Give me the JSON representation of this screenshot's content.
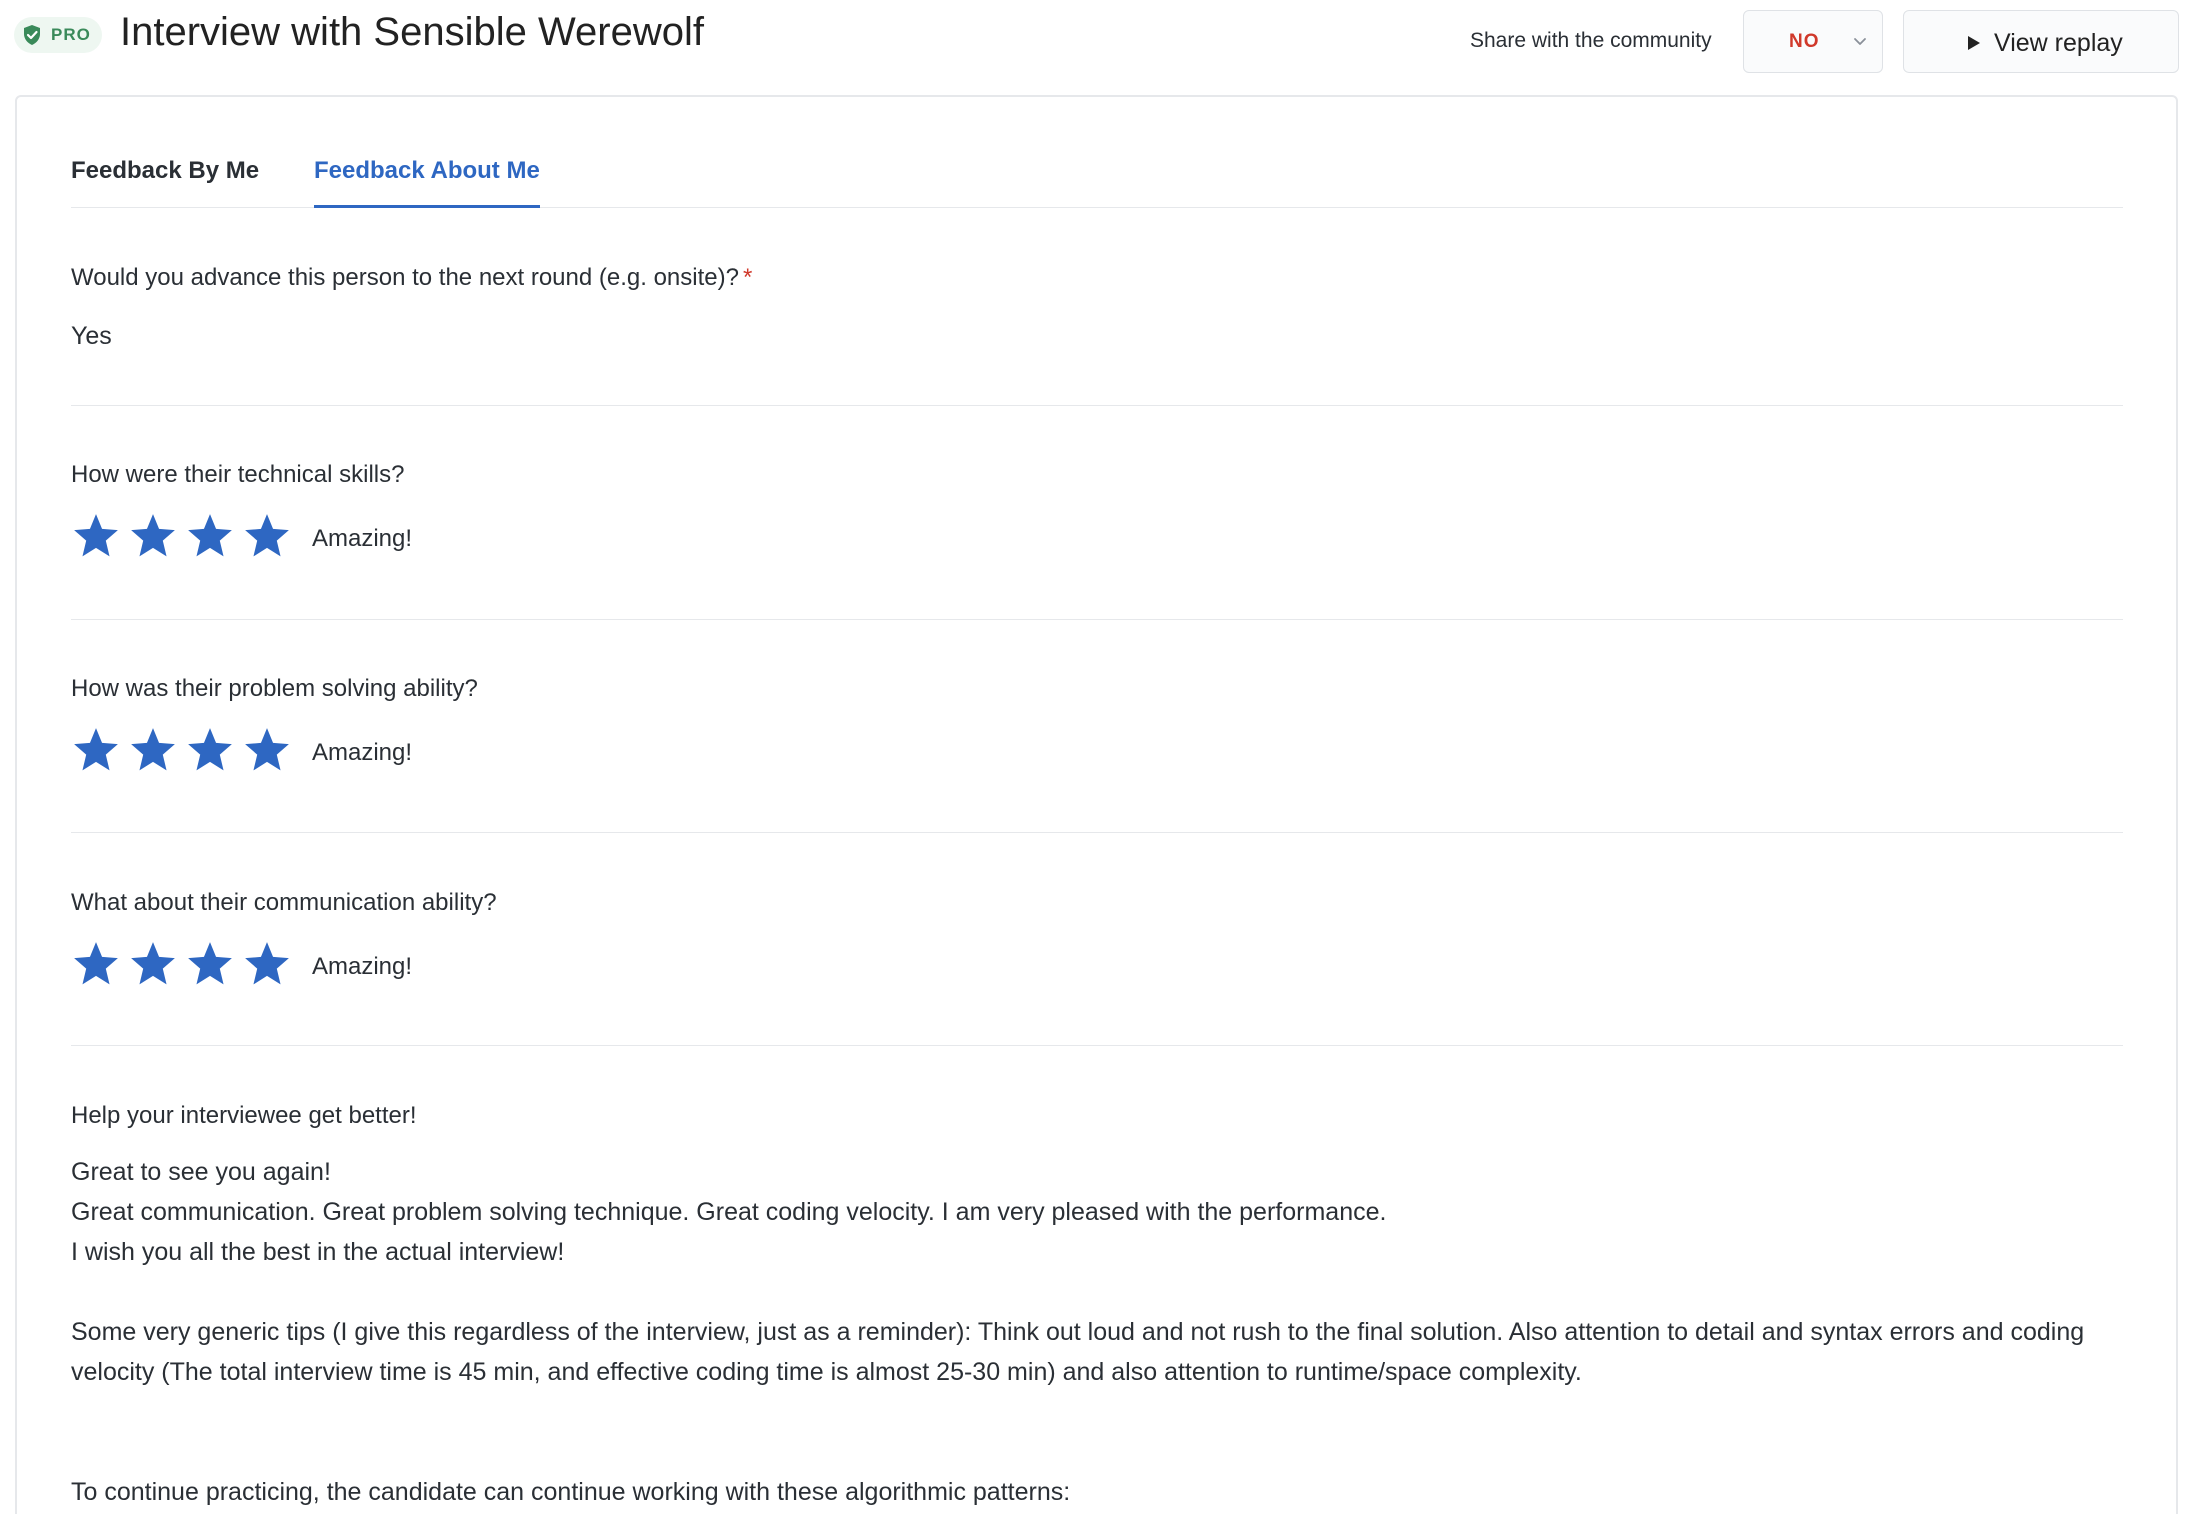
{
  "header": {
    "badge": "PRO",
    "title": "Interview with Sensible Werewolf",
    "share_label": "Share with the community",
    "share_value": "NO",
    "replay_label": "View replay"
  },
  "tabs": [
    {
      "label": "Feedback By Me",
      "active": false
    },
    {
      "label": "Feedback About Me",
      "active": true
    }
  ],
  "advance": {
    "question": "Would you advance this person to the next round (e.g. onsite)?",
    "required_mark": "*",
    "answer": "Yes"
  },
  "ratings": [
    {
      "question": "How were their technical skills?",
      "stars": 4,
      "label": "Amazing!"
    },
    {
      "question": "How was their problem solving ability?",
      "stars": 4,
      "label": "Amazing!"
    },
    {
      "question": "What about their communication ability?",
      "stars": 4,
      "label": "Amazing!"
    }
  ],
  "feedback": {
    "question": "Help your interviewee get better!",
    "lines": [
      "Great to see you again!",
      "Great communication. Great problem solving technique. Great coding velocity.  I am very pleased with the performance.",
      "I wish you all the best in the actual interview!",
      "",
      "Some very generic tips (I give this regardless of the interview, just as a reminder): Think out loud and not rush to the final solution. Also attention to detail and syntax errors and coding velocity (The total interview time is 45 min, and effective coding time is almost 25-30 min) and also attention to runtime/space complexity.",
      "",
      "",
      "To continue practicing, the candidate can continue working with these algorithmic patterns:"
    ]
  },
  "colors": {
    "accent": "#2e67c2",
    "star": "#2e67c2",
    "required": "#d0392b",
    "pro_green": "#3a8a5a"
  }
}
